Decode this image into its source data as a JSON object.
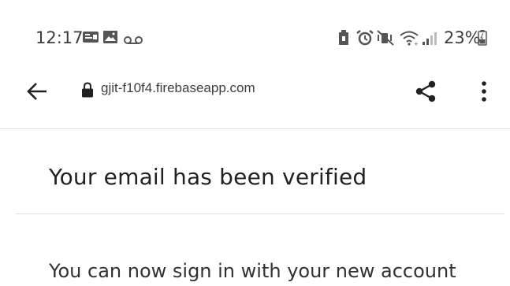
{
  "status_bar": {
    "time": "12:17",
    "battery_percent": "23%",
    "left_icons": [
      "notification-icon",
      "image-icon",
      "voicemail-icon"
    ],
    "right_icons": [
      "battery-saver-icon",
      "alarm-icon",
      "mute-icon",
      "wifi-icon",
      "signal-icon",
      "battery-icon"
    ]
  },
  "toolbar": {
    "url": "gjit-f10f4.firebaseapp.com",
    "icons": [
      "back-arrow-icon",
      "lock-icon",
      "share-icon",
      "more-vert-icon"
    ]
  },
  "page": {
    "title": "Your email has been verified",
    "message": "You can now sign in with your new account"
  }
}
